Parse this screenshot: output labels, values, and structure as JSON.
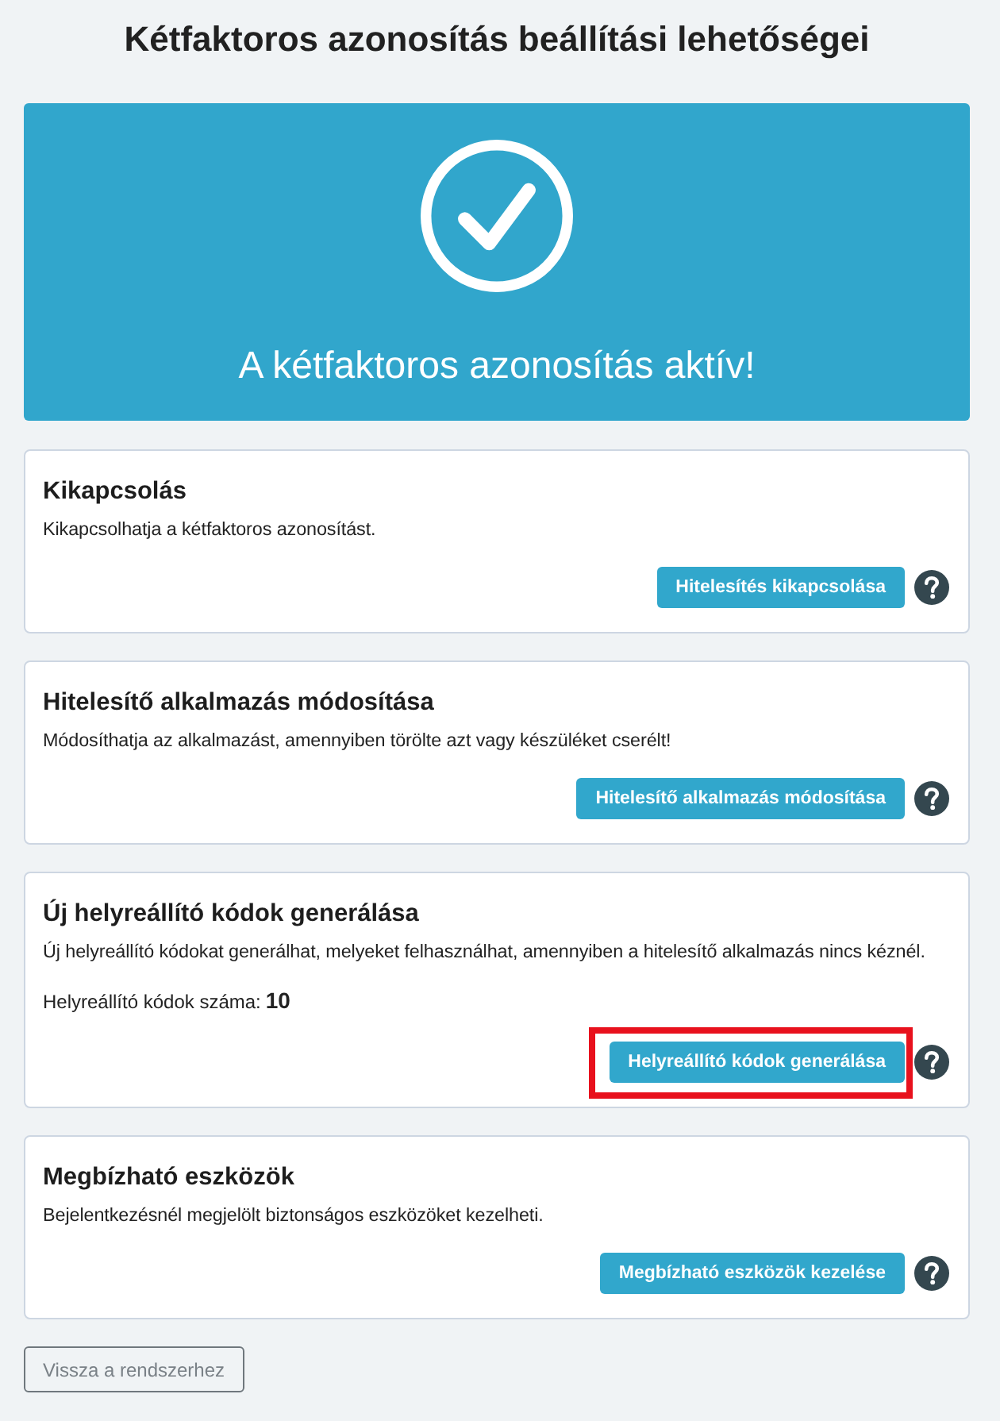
{
  "page": {
    "title": "Kétfaktoros azonosítás beállítási lehetőségei"
  },
  "status_banner": {
    "kind": "success",
    "message": "A kétfaktoros azonosítás aktív!"
  },
  "sections": [
    {
      "title": "Kikapcsolás",
      "description": "Kikapcsolhatja a kétfaktoros azonosítást.",
      "button": "Hitelesítés kikapcsolása",
      "highlighted": false
    },
    {
      "title": "Hitelesítő alkalmazás módosítása",
      "description": "Módosíthatja az alkalmazást, amennyiben törölte azt vagy készüléket cserélt!",
      "button": "Hitelesítő alkalmazás módosítása",
      "highlighted": false
    },
    {
      "title": "Új helyreállító kódok generálása",
      "description": "Új helyreállító kódokat generálhat, melyeket felhasználhat, amennyiben a hitelesítő alkalmazás nincs kéznél.",
      "count": {
        "label": "Helyreállító kódok száma:",
        "value": "10"
      },
      "button": "Helyreállító kódok generálása",
      "highlighted": true
    },
    {
      "title": "Megbízható eszközök",
      "description": "Bejelentkezésnél megjelölt biztonságos eszközöket kezelheti.",
      "button": "Megbízható eszközök kezelése",
      "highlighted": false
    }
  ],
  "back_button": "Vissza a rendszerhez"
}
